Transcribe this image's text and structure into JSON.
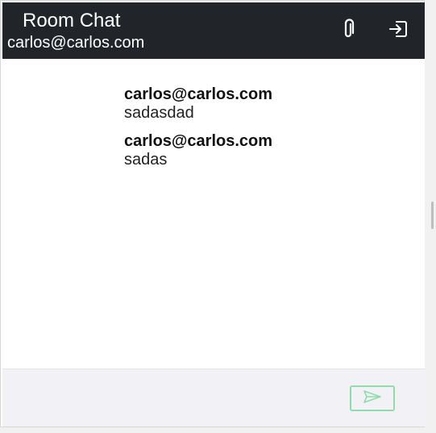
{
  "header": {
    "title": "Room Chat",
    "user_email": "carlos@carlos.com",
    "attach_icon": "paperclip-icon",
    "logout_icon": "sign-out-icon"
  },
  "messages": [
    {
      "author": "carlos@carlos.com",
      "text": "sadasdad"
    },
    {
      "author": "carlos@carlos.com",
      "text": "sadas"
    }
  ],
  "composer": {
    "input_value": "",
    "placeholder": "",
    "send_icon": "send-icon"
  },
  "colors": {
    "header_bg": "#212529",
    "send_border": "#8fdca9",
    "composer_bg": "#f2f2f6"
  }
}
